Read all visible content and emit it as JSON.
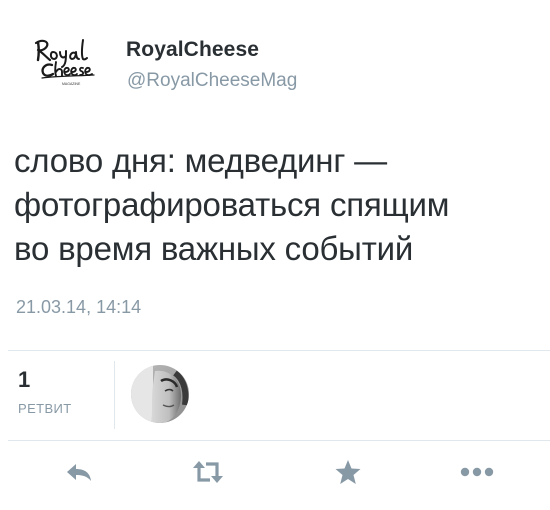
{
  "author": {
    "display_name": "RoyalCheese",
    "handle": "@RoyalCheeseMag",
    "logo_text": "Royal Cheese"
  },
  "tweet": {
    "lines": [
      "слово дня: медвединг —",
      "фотографироваться спящим",
      "во время важных событий"
    ],
    "timestamp": "21.03.14, 14:14"
  },
  "stats": {
    "retweet_count": "1",
    "retweet_label": "РЕТВИТ"
  },
  "actions": [
    {
      "name": "reply",
      "icon": "reply-icon"
    },
    {
      "name": "retweet",
      "icon": "retweet-icon"
    },
    {
      "name": "favorite",
      "icon": "star-icon"
    },
    {
      "name": "more",
      "icon": "more-dots-icon"
    }
  ],
  "colors": {
    "text": "#292f33",
    "secondary": "#8899a6",
    "divider": "#e1e8ed",
    "icon": "#8899a6"
  }
}
